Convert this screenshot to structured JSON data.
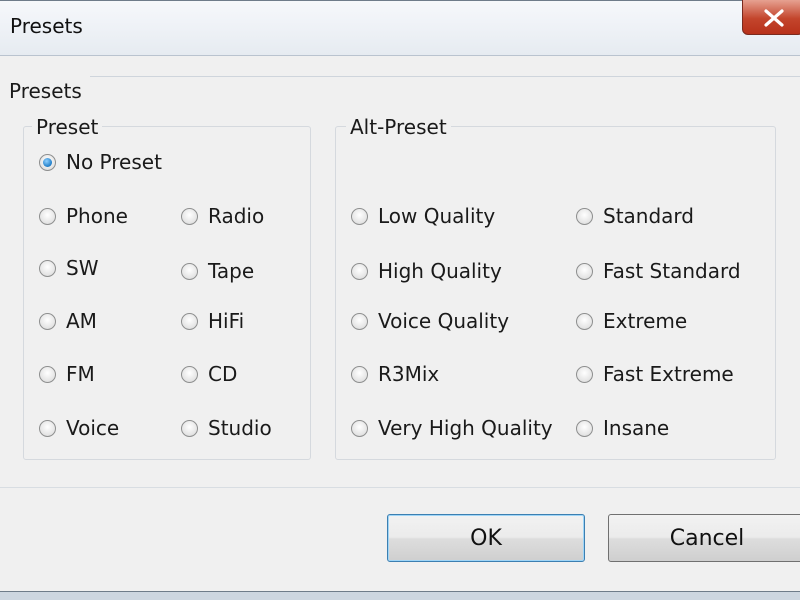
{
  "window": {
    "title": "Presets"
  },
  "presets": {
    "group_label": "Presets",
    "preset": {
      "legend": "Preset",
      "options": [
        {
          "label": "No Preset",
          "checked": true
        },
        {
          "label": "Phone",
          "checked": false
        },
        {
          "label": "Radio",
          "checked": false
        },
        {
          "label": "SW",
          "checked": false
        },
        {
          "label": "Tape",
          "checked": false
        },
        {
          "label": "AM",
          "checked": false
        },
        {
          "label": "HiFi",
          "checked": false
        },
        {
          "label": "FM",
          "checked": false
        },
        {
          "label": "CD",
          "checked": false
        },
        {
          "label": "Voice",
          "checked": false
        },
        {
          "label": "Studio",
          "checked": false
        }
      ]
    },
    "alt_preset": {
      "legend": "Alt-Preset",
      "options": [
        {
          "label": "Low Quality",
          "checked": false
        },
        {
          "label": "Standard",
          "checked": false
        },
        {
          "label": "High Quality",
          "checked": false
        },
        {
          "label": "Fast Standard",
          "checked": false
        },
        {
          "label": "Voice Quality",
          "checked": false
        },
        {
          "label": "Extreme",
          "checked": false
        },
        {
          "label": "R3Mix",
          "checked": false
        },
        {
          "label": "Fast Extreme",
          "checked": false
        },
        {
          "label": "Very High Quality",
          "checked": false
        },
        {
          "label": "Insane",
          "checked": false
        }
      ]
    }
  },
  "buttons": {
    "ok": "OK",
    "cancel": "Cancel"
  }
}
